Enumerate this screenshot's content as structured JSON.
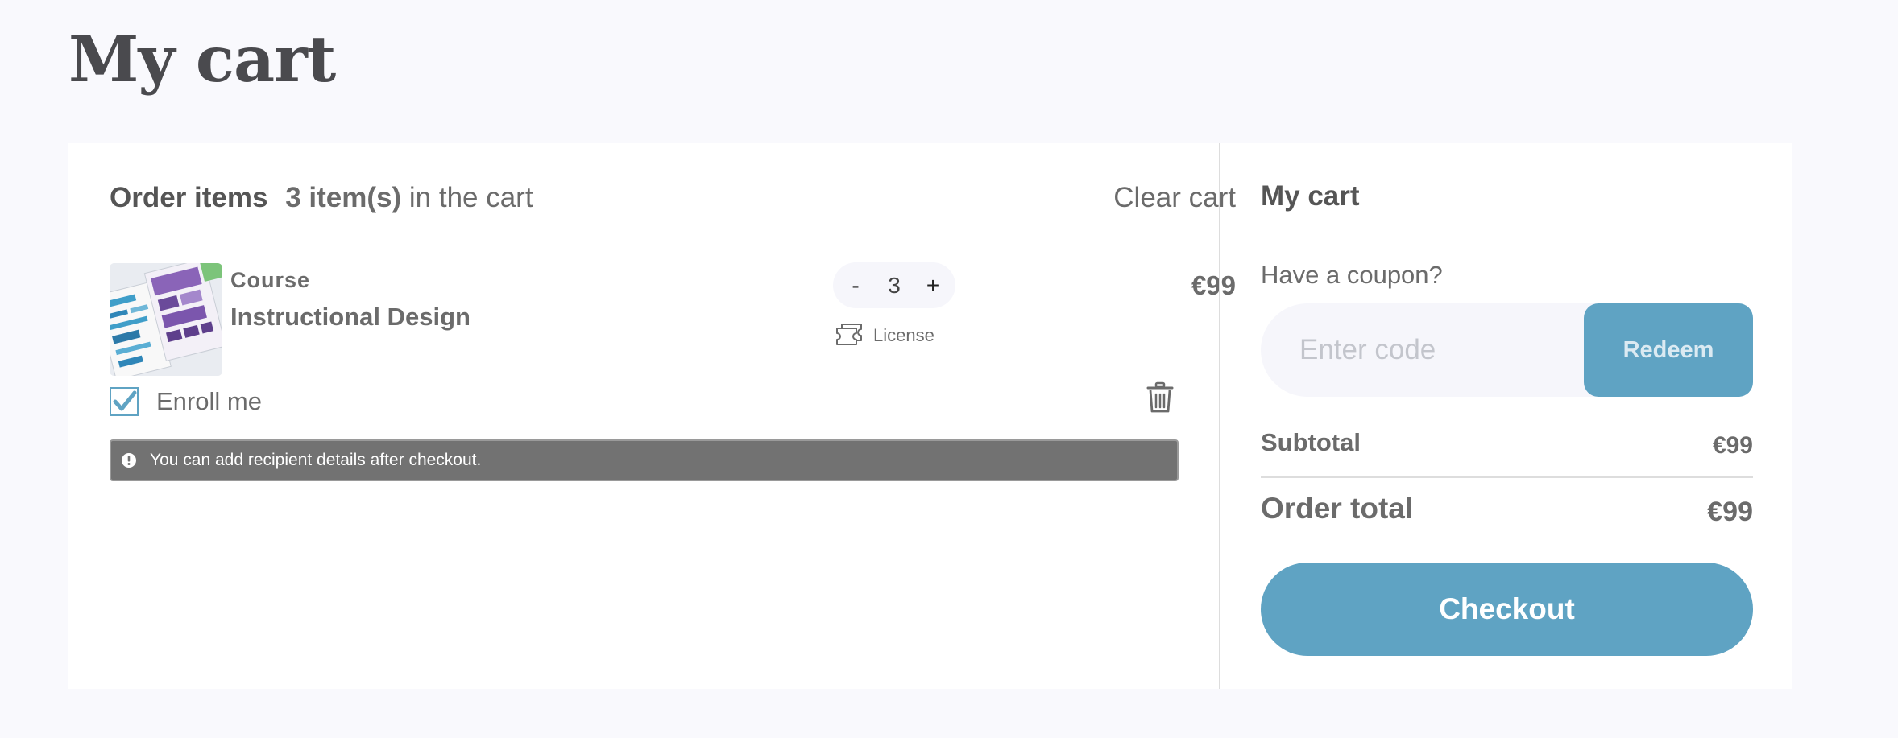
{
  "page": {
    "title": "My cart"
  },
  "order": {
    "heading": "Order items",
    "count_text": "3 item(s)",
    "count_suffix": "in the cart",
    "clear_label": "Clear cart"
  },
  "item": {
    "type": "Course",
    "name": "Instructional Design",
    "quantity": "3",
    "minus_label": "-",
    "plus_label": "+",
    "license_label": "License",
    "price": "€99",
    "enroll_label": "Enroll me",
    "enroll_checked": true,
    "thumbnail_icon": "course-thumbnail-image",
    "license_icon": "license-tickets-icon",
    "delete_icon": "trash-icon"
  },
  "notice": {
    "text": "You can add recipient details after checkout.",
    "icon": "info-circle-icon"
  },
  "summary": {
    "title": "My cart",
    "coupon_label": "Have a coupon?",
    "coupon_placeholder": "Enter code",
    "coupon_value": "",
    "redeem_label": "Redeem",
    "subtotal_label": "Subtotal",
    "subtotal_value": "€99",
    "total_label": "Order total",
    "total_value": "€99",
    "checkout_label": "Checkout"
  },
  "colors": {
    "accent": "#5fa3c3",
    "page_background": "#f9f9fd",
    "card_background": "#ffffff",
    "text": "#6b6b6b",
    "notice_background": "#727272"
  }
}
